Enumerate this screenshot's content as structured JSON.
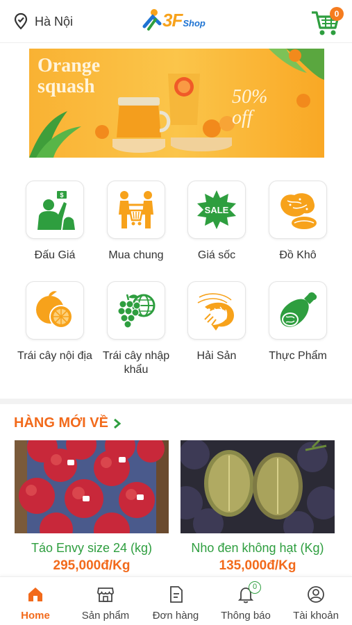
{
  "header": {
    "location": "Hà Nội",
    "logo_main": "3F",
    "logo_sub": "Shop",
    "cart_count": "0",
    "icons": {
      "location": "location-pin-icon",
      "cart": "shopping-cart-icon"
    }
  },
  "banner": {
    "title": "Orange\nsquash",
    "discount": "50%\noff"
  },
  "categories": [
    {
      "label": "Đấu Giá",
      "icon": "auction-icon"
    },
    {
      "label": "Mua chung",
      "icon": "group-buy-icon"
    },
    {
      "label": "Giá sốc",
      "icon": "sale-icon",
      "badge_text": "SALE"
    },
    {
      "label": "Đồ Khô",
      "icon": "dried-food-icon"
    },
    {
      "label": "Trái cây nội địa",
      "icon": "orange-icon"
    },
    {
      "label": "Trái cây nhập khẩu",
      "icon": "grape-globe-icon"
    },
    {
      "label": "Hải Sản",
      "icon": "shrimp-icon"
    },
    {
      "label": "Thực Phẩm",
      "icon": "meat-icon"
    }
  ],
  "new_arrivals": {
    "title": "HÀNG MỚI VỀ",
    "products": [
      {
        "name": "Táo Envy size 24 (kg)",
        "price": "295,000đ/Kg"
      },
      {
        "name": "Nho đen không hạt (Kg)",
        "price": "135,000đ/Kg"
      }
    ]
  },
  "bottom_nav": [
    {
      "label": "Home",
      "icon": "home-icon",
      "active": true
    },
    {
      "label": "Sản phẩm",
      "icon": "store-icon",
      "active": false
    },
    {
      "label": "Đơn hàng",
      "icon": "order-icon",
      "active": false
    },
    {
      "label": "Thông báo",
      "icon": "bell-icon",
      "active": false,
      "badge": "0"
    },
    {
      "label": "Tài khoản",
      "icon": "user-icon",
      "active": false
    }
  ],
  "colors": {
    "accent_orange": "#f26a1b",
    "accent_green": "#2e9e3f",
    "icon_orange": "#f7a21b"
  }
}
